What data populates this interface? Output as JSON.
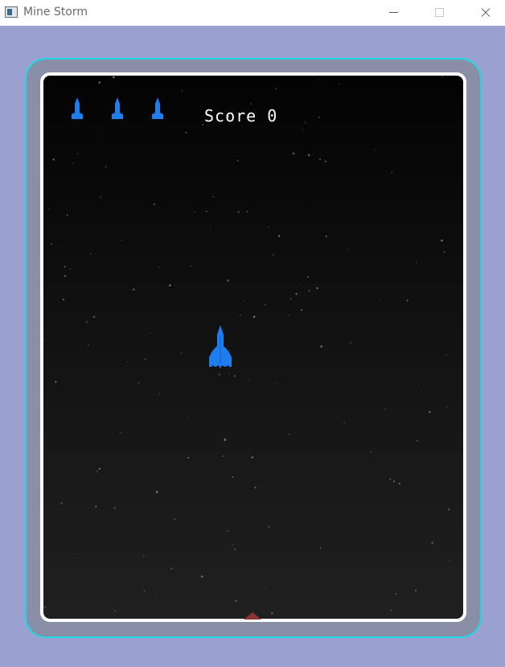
{
  "window": {
    "title": "Mine Storm"
  },
  "game": {
    "score_text": "Score 0",
    "lives": 3,
    "ship_color": "#1e7ef0",
    "frame_color": "#1ed8e6",
    "mine_color": "#8c3434"
  },
  "icons": {
    "life": "rocket-icon",
    "player": "rocket-ship",
    "mine": "mine-triangle"
  }
}
